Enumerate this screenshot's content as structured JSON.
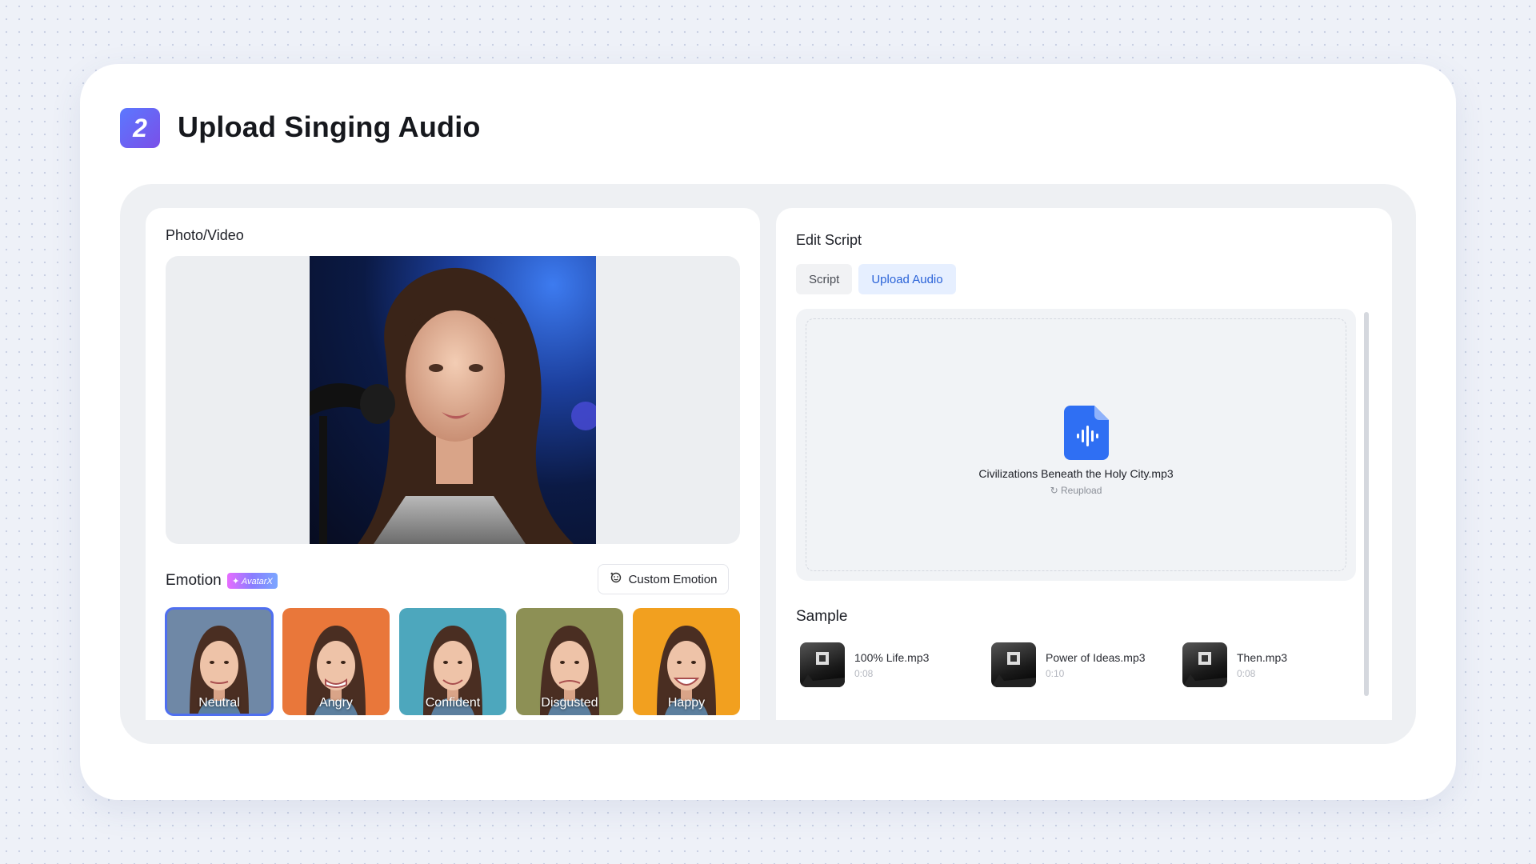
{
  "header": {
    "step_number": "2",
    "title": "Upload Singing Audio"
  },
  "left_panel": {
    "heading": "Photo/Video",
    "emotion_label": "Emotion",
    "emotion_badge": "✦ AvatarX",
    "custom_emotion_button": "Custom Emotion",
    "emotions": [
      {
        "label": "Neutral",
        "selected": true,
        "bg": "#6f88a6"
      },
      {
        "label": "Angry",
        "selected": false,
        "bg": "#e9773a"
      },
      {
        "label": "Confident",
        "selected": false,
        "bg": "#4da7bd"
      },
      {
        "label": "Disgusted",
        "selected": false,
        "bg": "#8d9055"
      },
      {
        "label": "Happy",
        "selected": false,
        "bg": "#f2a01f"
      }
    ]
  },
  "right_panel": {
    "heading": "Edit Script",
    "tabs": [
      {
        "label": "Script",
        "active": false
      },
      {
        "label": "Upload Audio",
        "active": true
      }
    ],
    "uploaded_file": "Civilizations Beneath the Holy City.mp3",
    "reupload_label": "Reupload",
    "sample_label": "Sample",
    "samples": [
      {
        "title": "100% Life.mp3",
        "duration": "0:08"
      },
      {
        "title": "Power of Ideas.mp3",
        "duration": "0:10"
      },
      {
        "title": "Then.mp3",
        "duration": "0:08"
      }
    ]
  },
  "colors": {
    "accent": "#2a63d8",
    "step_badge_start": "#5b78ff",
    "step_badge_end": "#7a4fe8",
    "file_icon": "#2f6ff3"
  }
}
